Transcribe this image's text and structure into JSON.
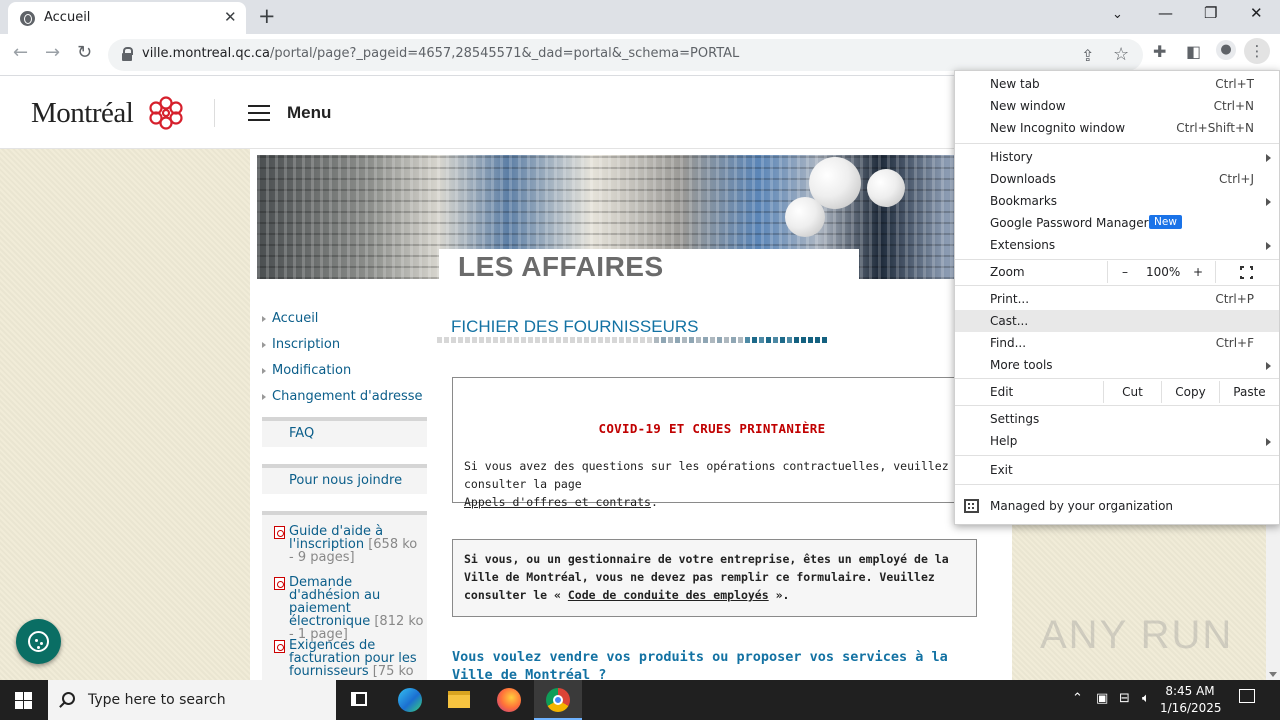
{
  "browser": {
    "tab_title": "Accueil",
    "url_host": "ville.montreal.qc.ca",
    "url_rest": "/portal/page?_pageid=4657,28545571&_dad=portal&_schema=PORTAL"
  },
  "site": {
    "logo_text": "Montréal",
    "menu_label": "Menu",
    "banner_title": "LES AFFAIRES",
    "nav_links": [
      "Accueil",
      "Inscription",
      "Modification",
      "Changement d'adresse"
    ],
    "nav_boxes": [
      "FAQ",
      "Pour nous joindre"
    ],
    "documents": [
      {
        "title": "Guide d'aide à l'inscription",
        "meta": "[658 ko - 9 pages]"
      },
      {
        "title": "Demande d'adhésion au paiement électronique",
        "meta": "[812 ko - 1 page]"
      },
      {
        "title": "Exigences de facturation pour les fournisseurs",
        "meta": "[75 ko"
      }
    ],
    "section_title": "FICHIER DES FOURNISSEURS",
    "notice1": {
      "heading": "COVID-19 ET CRUES PRINTANIÈRE",
      "body": "Si vous avez des questions sur les opérations contractuelles, veuillez consulter la page",
      "link": "Appels d'offres et contrats"
    },
    "notice2": {
      "body_start": "Si vous, ou un gestionnaire de votre entreprise, êtes un employé de la Ville de Montréal, vous ne devez pas remplir ce formulaire. Veuillez consulter le «",
      "link": "Code de conduite des employés",
      "body_end": "»."
    },
    "vendre": "Vous voulez vendre vos produits ou proposer vos services à la Ville de Montréal ?"
  },
  "chrome_menu": {
    "group1": [
      {
        "label": "New tab",
        "shortcut": "Ctrl+T"
      },
      {
        "label": "New window",
        "shortcut": "Ctrl+N"
      },
      {
        "label": "New Incognito window",
        "shortcut": "Ctrl+Shift+N"
      }
    ],
    "group2": [
      {
        "label": "History"
      },
      {
        "label": "Downloads",
        "shortcut": "Ctrl+J"
      },
      {
        "label": "Bookmarks"
      },
      {
        "label": "Google Password Manager",
        "badge": "New"
      },
      {
        "label": "Extensions"
      }
    ],
    "zoom": {
      "label": "Zoom",
      "minus": "–",
      "value": "100%",
      "plus": "+"
    },
    "group3": [
      {
        "label": "Print...",
        "shortcut": "Ctrl+P"
      },
      {
        "label": "Cast..."
      },
      {
        "label": "Find...",
        "shortcut": "Ctrl+F"
      },
      {
        "label": "More tools"
      }
    ],
    "edit": {
      "label": "Edit",
      "cut": "Cut",
      "copy": "Copy",
      "paste": "Paste"
    },
    "group4": [
      {
        "label": "Settings"
      },
      {
        "label": "Help"
      }
    ],
    "exit": "Exit",
    "managed": "Managed by your organization"
  },
  "watermark": "ANY RUN",
  "taskbar": {
    "search_placeholder": "Type here to search",
    "time": "8:45 AM",
    "date": "1/16/2025"
  },
  "colors": {
    "link": "#0b5e8a",
    "section_title": "#1372a3",
    "covid_heading": "#c00000",
    "new_badge": "#1a73e8"
  }
}
